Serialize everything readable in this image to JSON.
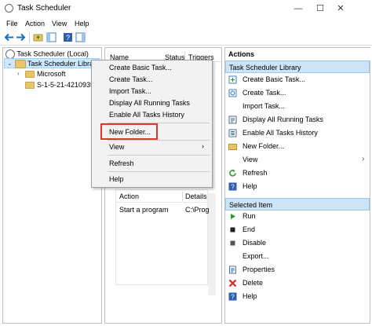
{
  "window": {
    "title": "Task Scheduler",
    "minimize": "—",
    "maximize": "☐",
    "close": "✕"
  },
  "menu": [
    "File",
    "Action",
    "View",
    "Help"
  ],
  "tree": {
    "root": "Task Scheduler (Local)",
    "library": "Task Scheduler Library",
    "children": [
      "Microsoft",
      "S-1-5-21-42109359"
    ]
  },
  "list": {
    "col_name": "Name",
    "col_status": "Status",
    "col_triggers": "Triggers"
  },
  "details": {
    "col_action": "Action",
    "col_details": "Details",
    "row_action": "Start a program",
    "row_details": "C:\\Prog"
  },
  "context_menu": {
    "items": [
      "Create Basic Task...",
      "Create Task...",
      "Import Task...",
      "Display All Running Tasks",
      "Enable All Tasks History"
    ],
    "new_folder": "New Folder...",
    "view": "View",
    "view_arrow": "›",
    "refresh": "Refresh",
    "help": "Help"
  },
  "actions": {
    "header": "Actions",
    "library_section": "Task Scheduler Library",
    "library_items": [
      {
        "label": "Create Basic Task...",
        "icon": "create-basic-task-icon"
      },
      {
        "label": "Create Task...",
        "icon": "create-task-icon"
      },
      {
        "label": "Import Task...",
        "icon": "import-task-icon"
      },
      {
        "label": "Display All Running Tasks",
        "icon": "running-tasks-icon"
      },
      {
        "label": "Enable All Tasks History",
        "icon": "history-icon"
      },
      {
        "label": "New Folder...",
        "icon": "folder-icon"
      },
      {
        "label": "View",
        "icon": "view-icon"
      },
      {
        "label": "Refresh",
        "icon": "refresh-icon"
      },
      {
        "label": "Help",
        "icon": "help-icon"
      }
    ],
    "selected_section": "Selected Item",
    "selected_items": [
      {
        "label": "Run",
        "icon": "run-icon"
      },
      {
        "label": "End",
        "icon": "end-icon"
      },
      {
        "label": "Disable",
        "icon": "disable-icon"
      },
      {
        "label": "Export...",
        "icon": "export-icon"
      },
      {
        "label": "Properties",
        "icon": "properties-icon"
      },
      {
        "label": "Delete",
        "icon": "delete-icon"
      },
      {
        "label": "Help",
        "icon": "help-icon"
      }
    ]
  },
  "colors": {
    "highlight_border": "#d93a2e",
    "section_bg": "#cce4f7",
    "accent": "#1a6fc4"
  }
}
